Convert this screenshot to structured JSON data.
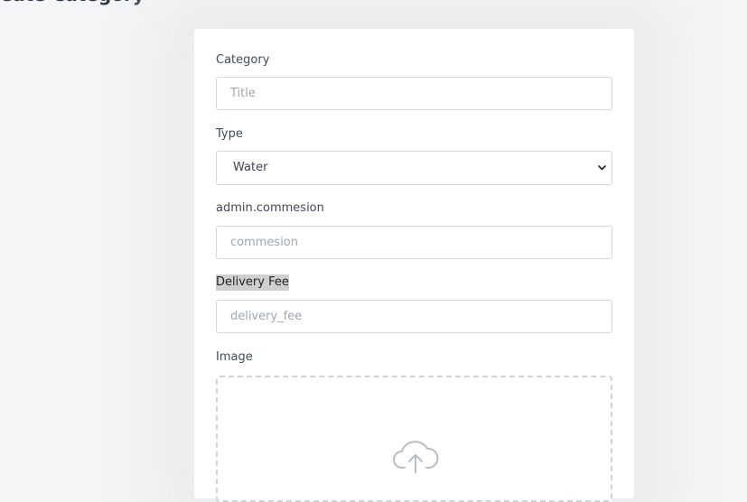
{
  "page": {
    "title": "Create Category"
  },
  "form": {
    "category": {
      "label": "Category",
      "placeholder": "Title",
      "value": ""
    },
    "type": {
      "label": "Type",
      "selected": "Water",
      "icon": "chevron-down-icon"
    },
    "commission": {
      "label": "admin.commesion",
      "placeholder": "commesion",
      "value": ""
    },
    "delivery_fee": {
      "label": "Delivery Fee",
      "placeholder": "delivery_fee",
      "value": ""
    },
    "image": {
      "label": "Image",
      "icon": "cloud-upload-icon"
    }
  },
  "colors": {
    "background": "#f4f5f6",
    "card": "#ffffff",
    "border": "#d5d9de",
    "label_highlight": "#cfcfcf"
  }
}
